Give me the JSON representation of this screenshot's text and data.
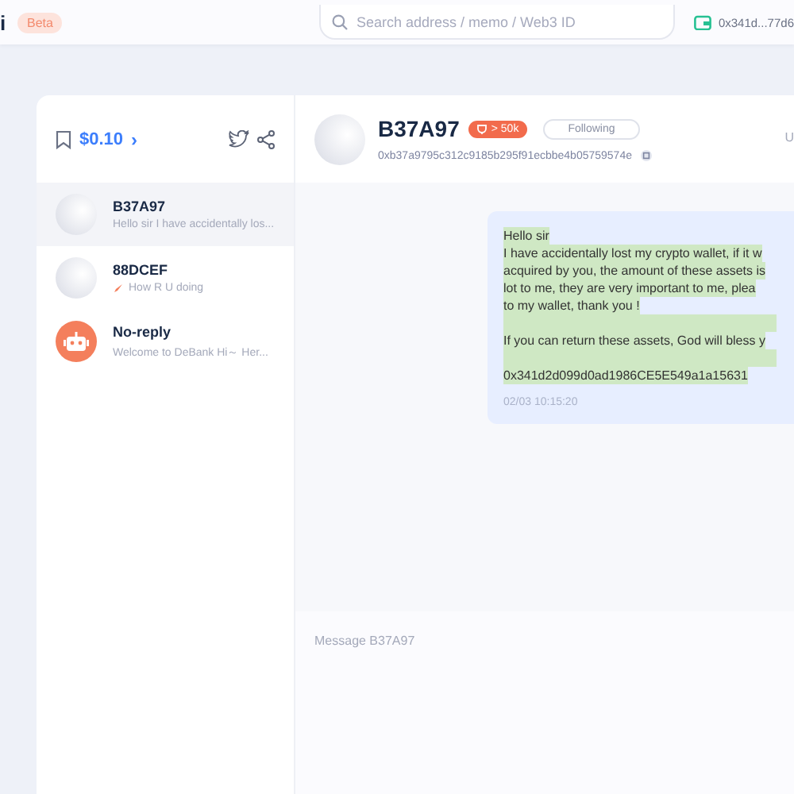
{
  "topbar": {
    "logo_text": "i",
    "badge": "Beta",
    "search": {
      "placeholder": "Search address / memo / Web3 ID"
    },
    "wallet": "0x341d...77d6"
  },
  "sidebar": {
    "balance": "$0.10",
    "chevron": "›",
    "conversations": [
      {
        "name": "B37A97",
        "preview": "Hello sir I have accidentally los...",
        "selected": true,
        "kind": "user"
      },
      {
        "name": "88DCEF",
        "preview": "How R U doing",
        "selected": false,
        "kind": "user",
        "preview_icon": true
      },
      {
        "name": "No-reply",
        "preview": "Welcome to DeBank Hi～ Her...",
        "selected": false,
        "kind": "bot"
      }
    ]
  },
  "chat": {
    "name": "B37A97",
    "badge": "> 50k",
    "follow_button": "Following",
    "address": "0xb37a9795c312c9185b295f91ecbbe4b05759574e",
    "header_right_text": "U",
    "messages": [
      {
        "paragraphs": [
          [
            "Hello sir",
            "I have accidentally lost my crypto wallet, if it w",
            "acquired by you, the amount of these assets is",
            "lot to me, they are very important to me, plea",
            "to my wallet, thank you !"
          ],
          [
            "If you can return these assets, God will bless y"
          ],
          [
            "0x341d2d099d0ad1986CE5E549a1a15631"
          ]
        ],
        "time": "02/03 10:15:20"
      }
    ],
    "input": {
      "placeholder": "Message B37A97"
    }
  }
}
